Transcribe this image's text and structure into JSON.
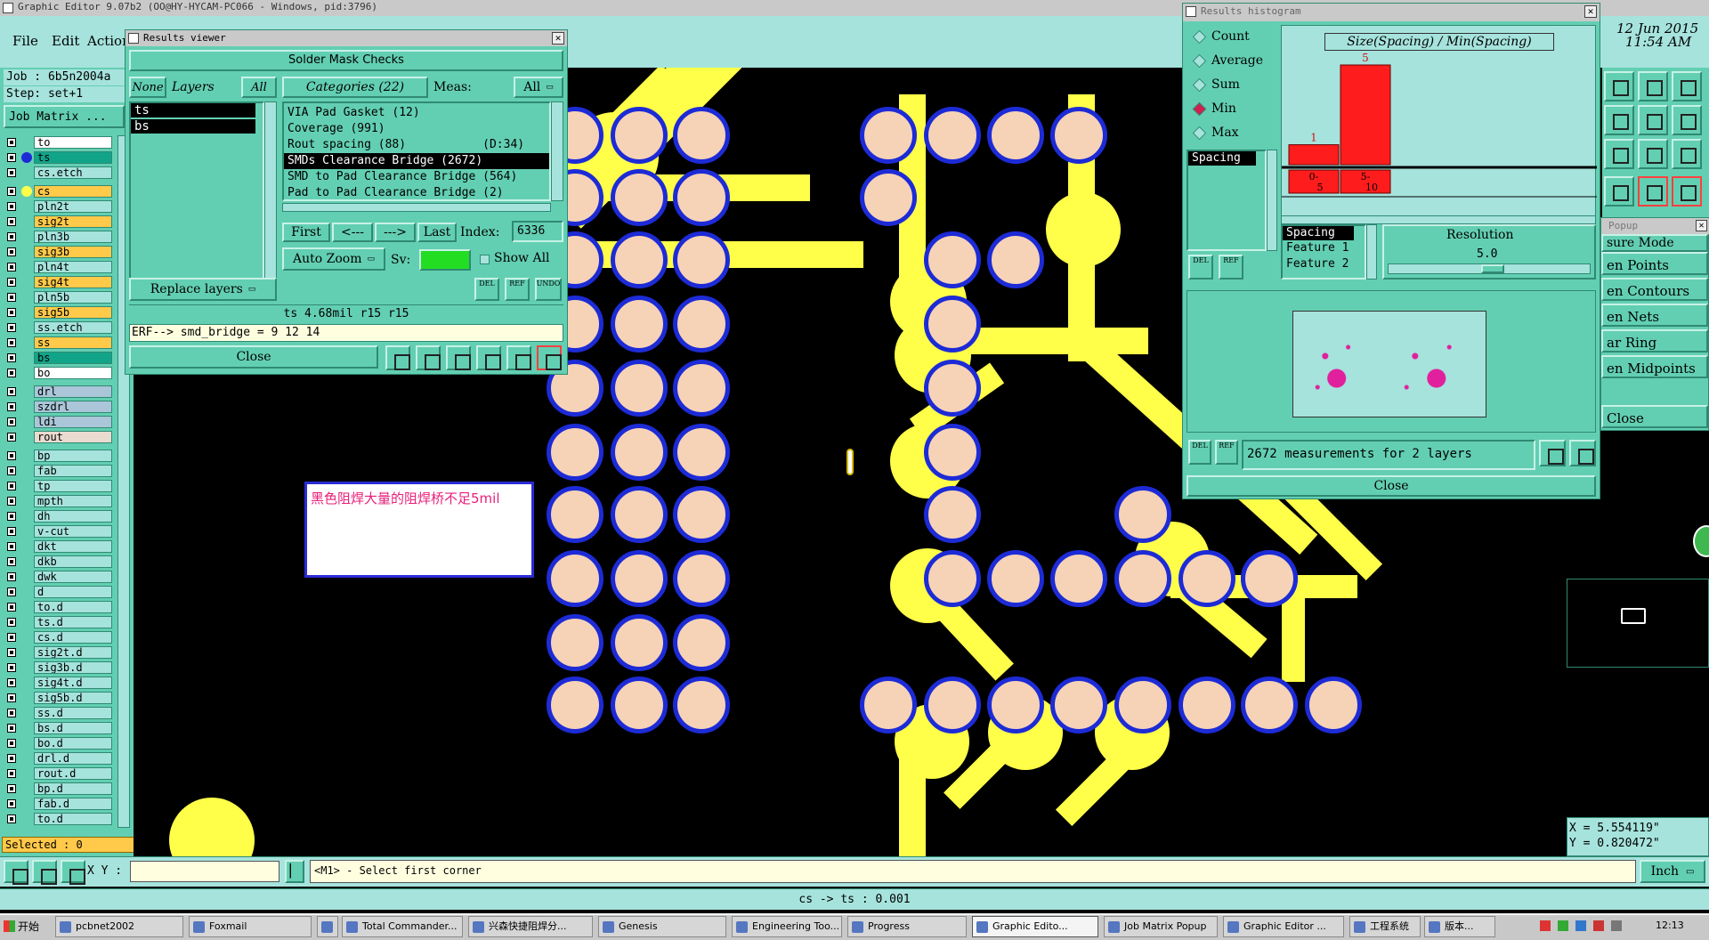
{
  "main_window": {
    "title": "Graphic Editor 9.07b2 (OO@HY-HYCAM-PC066 - Windows, pid:3796)",
    "menu": [
      "File",
      "Edit",
      "Action"
    ],
    "job_label": "Job : 6b5n2004a",
    "step_label": "Step: set+1",
    "job_matrix_button": "Job Matrix ...",
    "date": "12 Jun 2015",
    "time": "11:54 AM",
    "selected": "Selected : 0",
    "xy_label": "X Y :",
    "xy_value": "",
    "prompt": "<M1> - Select first corner",
    "units": "Inch",
    "status_line": "cs -> ts : 0.001",
    "coord_x": "X = 5.554119\"",
    "coord_y": "Y = 0.820472\""
  },
  "layers": [
    {
      "name": "to",
      "color": "#ffffff"
    },
    {
      "name": "ts",
      "color": "#12a488",
      "marker": "#1d2bd6"
    },
    {
      "name": "cs.etch",
      "color": "#a6e3dd"
    },
    {
      "name": "cs",
      "color": "#ffc94a",
      "marker": "#ffff4a"
    },
    {
      "name": "pln2t",
      "color": "#a6e3dd"
    },
    {
      "name": "sig2t",
      "color": "#ffc94a"
    },
    {
      "name": "pln3b",
      "color": "#a6e3dd"
    },
    {
      "name": "sig3b",
      "color": "#ffc94a"
    },
    {
      "name": "pln4t",
      "color": "#a6e3dd"
    },
    {
      "name": "sig4t",
      "color": "#ffc94a"
    },
    {
      "name": "pln5b",
      "color": "#a6e3dd"
    },
    {
      "name": "sig5b",
      "color": "#ffc94a"
    },
    {
      "name": "ss.etch",
      "color": "#a6e3dd"
    },
    {
      "name": "ss",
      "color": "#ffc94a"
    },
    {
      "name": "bs",
      "color": "#12a488"
    },
    {
      "name": "bo",
      "color": "#ffffff"
    },
    {
      "name": "drl",
      "color": "#aac6d8"
    },
    {
      "name": "szdrl",
      "color": "#aac6d8"
    },
    {
      "name": "ldi",
      "color": "#aac6d8"
    },
    {
      "name": "rout",
      "color": "#eadbd0"
    },
    {
      "name": "bp",
      "color": "#a6e3dd"
    },
    {
      "name": "fab",
      "color": "#a6e3dd"
    },
    {
      "name": "tp",
      "color": "#a6e3dd"
    },
    {
      "name": "mpth",
      "color": "#a6e3dd"
    },
    {
      "name": "dh",
      "color": "#a6e3dd"
    },
    {
      "name": "v-cut",
      "color": "#a6e3dd"
    },
    {
      "name": "dkt",
      "color": "#a6e3dd"
    },
    {
      "name": "dkb",
      "color": "#a6e3dd"
    },
    {
      "name": "dwk",
      "color": "#a6e3dd"
    },
    {
      "name": "d",
      "color": "#a6e3dd"
    },
    {
      "name": "to.d",
      "color": "#a6e3dd"
    },
    {
      "name": "ts.d",
      "color": "#a6e3dd"
    },
    {
      "name": "cs.d",
      "color": "#a6e3dd"
    },
    {
      "name": "sig2t.d",
      "color": "#a6e3dd"
    },
    {
      "name": "sig3b.d",
      "color": "#a6e3dd"
    },
    {
      "name": "sig4t.d",
      "color": "#a6e3dd"
    },
    {
      "name": "sig5b.d",
      "color": "#a6e3dd"
    },
    {
      "name": "ss.d",
      "color": "#a6e3dd"
    },
    {
      "name": "bs.d",
      "color": "#a6e3dd"
    },
    {
      "name": "bo.d",
      "color": "#a6e3dd"
    },
    {
      "name": "drl.d",
      "color": "#a6e3dd"
    },
    {
      "name": "rout.d",
      "color": "#a6e3dd"
    },
    {
      "name": "bp.d",
      "color": "#a6e3dd"
    },
    {
      "name": "fab.d",
      "color": "#a6e3dd"
    },
    {
      "name": "to.d",
      "color": "#a6e3dd"
    }
  ],
  "results_viewer": {
    "title": "Results viewer",
    "header": "Solder Mask Checks",
    "none_btn": "None",
    "layers_label": "Layers",
    "all_btn": "All",
    "layers": [
      "ts",
      "bs"
    ],
    "categories_label": "Categories (22)",
    "meas_label": "Meas:",
    "meas_value": "All",
    "categories": [
      "VIA Pad Gasket (12)",
      "Coverage (991)",
      "Rout spacing (88)           (D:34)",
      "SMDs Clearance Bridge (2672)",
      "SMD to Pad Clearance Bridge (564)",
      "Pad to Pad Clearance Bridge (2)"
    ],
    "selected_category": 3,
    "first_btn": "First",
    "prev_btn": "<---",
    "next_btn": "--->",
    "last_btn": "Last",
    "index_label": "Index:",
    "index_value": "6336",
    "auto_zoom": "Auto Zoom",
    "sv_label": "Sv:",
    "show_all": "Show All",
    "replace_layers": "Replace layers",
    "del_label": "DEL",
    "ref_label": "REF",
    "undo_label": "UNDO",
    "measure_line": "ts 4.68mil  r15  r15",
    "erf_line": "ERF--> smd_bridge = 9 12 14",
    "close": "Close"
  },
  "annotation": "黑色阻焊大量的阻焊桥不足5mil",
  "histogram": {
    "title": "Results histogram",
    "radio": [
      "Count",
      "Average",
      "Sum",
      "Min",
      "Max"
    ],
    "radio_selected": 3,
    "list_item": "Spacing",
    "chart_title": "Size(Spacing) / Min(Spacing)",
    "features": [
      "Spacing",
      "Feature 1",
      "Feature 2"
    ],
    "resolution_label": "Resolution",
    "resolution_value": "5.0",
    "summary": "2672 measurements for 2 layers",
    "del_label": "DEL",
    "ref_label": "REF",
    "close": "Close"
  },
  "chart_data": {
    "type": "bar",
    "title": "Size(Spacing) / Min(Spacing)",
    "categories": [
      "0-5",
      "5-10"
    ],
    "values": [
      1,
      5
    ],
    "bar_color": "#ff1c1c"
  },
  "popup": {
    "title": "Popup",
    "items": [
      "sure Mode",
      "en Points",
      "en Contours",
      "en Nets",
      "ar Ring",
      "en Midpoints"
    ],
    "close": "Close"
  },
  "taskbar": {
    "start": "开始",
    "items": [
      "pcbnet2002",
      "Foxmail",
      "",
      "Total Commander...",
      "兴森快捷阻焊分...",
      "Genesis",
      "Engineering Too...",
      "Progress",
      "Graphic Edito...",
      "Job Matrix Popup",
      "Graphic Editor ...",
      "工程系统",
      "版本..."
    ],
    "active_index": 8,
    "clock": "12:13"
  }
}
